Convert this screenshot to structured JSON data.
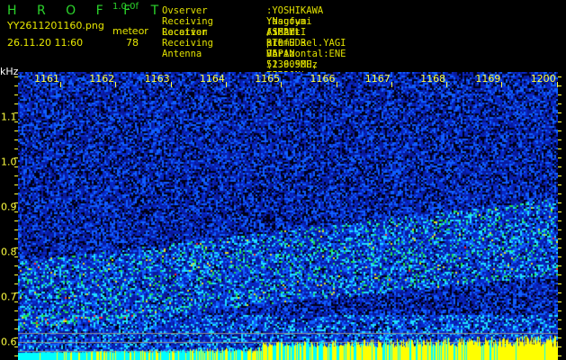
{
  "header": {
    "app_title": "H R O F F T",
    "version": "1.0.0f",
    "filename": "YY2611201160.png",
    "mode_label": "meteor",
    "datetime": "26.11.20 11:60",
    "count": "78"
  },
  "info": [
    {
      "key": "Ovserver",
      "value": ":YOSHIKAWA Yasufumi /JG2MLI"
    },
    {
      "key": "Receiving Location",
      "value": ":Nagoya Aichi-pref. JAPAN (136.90E, 35.20N)"
    },
    {
      "key": "Receiver",
      "value": ":SMArt RTL-SDR V5 52.905MHz USB TACHIKAWA"
    },
    {
      "key": "Receiving Antenna",
      "value": ":10mH 3el.YAGI Horizontal:ENE"
    }
  ],
  "colors": {
    "noise": "#0a1a9a",
    "signal_low": "#1ee0ff",
    "signal_mid": "#20e050",
    "signal_high": "#ff2020",
    "bar_low": "#00ffff",
    "bar_high": "#ffff00",
    "axis": "#ffff40"
  },
  "chart_data": {
    "type": "heatmap",
    "title": "HROFFT spectrogram",
    "ylabel": "kHz",
    "x_tick_labels": [
      "1161",
      "1162",
      "1163",
      "1164",
      "1165",
      "1166",
      "1167",
      "1168",
      "1169",
      "1200"
    ],
    "y_ticks": [
      0.6,
      0.7,
      0.8,
      0.9,
      1.0,
      1.1
    ],
    "y_tick_labels": [
      "0.6",
      "0.7",
      "0.8",
      "0.9",
      "1.0",
      "1.1"
    ],
    "ylim": [
      0.56,
      1.2
    ],
    "reference_lines_khz": [
      0.58,
      0.6,
      0.62
    ],
    "meteor_band": {
      "start_khz": [
        0.63,
        0.78
      ],
      "end_khz": [
        0.75,
        0.92
      ]
    }
  }
}
